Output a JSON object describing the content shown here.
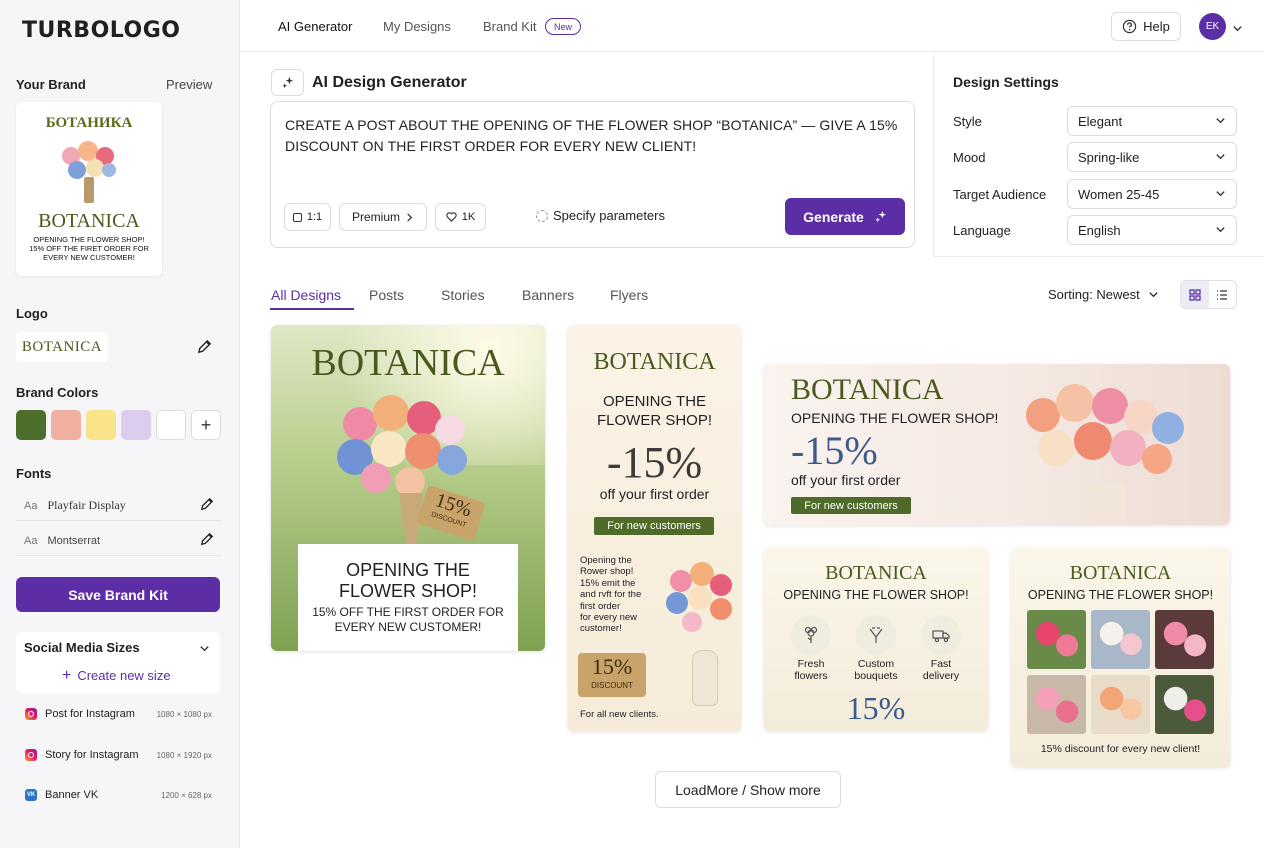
{
  "app": {
    "logo": "TURBOLOGO"
  },
  "sidebar": {
    "your_brand": "Your Brand",
    "preview": "Preview",
    "preview_card": {
      "title_ru": "БОТАНИКА",
      "title": "BOTANICA",
      "line1": "OPENING THE FLOWER SHOP!",
      "line2": "15% OFF THE FIRET ORDER FOR",
      "line3": "EVERY NEW CUSTOMER!"
    },
    "logo_label": "Logo",
    "logo_text": "BOTANICA",
    "brand_colors_label": "Brand Colors",
    "brand_colors": [
      "#4e6e2c",
      "#f0b0a0",
      "#f9e48a",
      "#dccdee",
      "#ffffff"
    ],
    "fonts_label": "Fonts",
    "fonts": [
      {
        "prefix": "Aa",
        "name": "Playfair Display"
      },
      {
        "prefix": "Aa",
        "name": "Montserrat"
      }
    ],
    "save_label": "Save Brand Kit",
    "sizes_label": "Social Media Sizes",
    "create_size": "Create new size",
    "sizes": [
      {
        "name": "Post for Instagram",
        "dims": "1080 × 1080 px"
      },
      {
        "name": "Story for Instagram",
        "dims": "1080 × 1920 px"
      },
      {
        "name": "Banner VK",
        "dims": "1200 × 628 px",
        "icon_text": "VK"
      }
    ]
  },
  "topnav": {
    "items": [
      "AI Generator",
      "My Designs",
      "Brand Kit"
    ],
    "new_badge": "New",
    "help": "Help",
    "avatar": "EK"
  },
  "generator": {
    "title": "AI Design Generator",
    "prompt": "CREATE A POST ABOUT THE OPENING OF THE FLOWER SHOP “BOTANICA” — GIVE A 15% DISCOUNT ON THE FIRST ORDER FOR EVERY NEW CLIENT!",
    "ratio": "1:1",
    "quality": "Premium",
    "count": "1K",
    "specify": "Specify parameters",
    "generate": "Generate"
  },
  "settings": {
    "title": "Design Settings",
    "fields": [
      {
        "label": "Style",
        "value": "Elegant"
      },
      {
        "label": "Mood",
        "value": "Spring-like"
      },
      {
        "label": "Target Audience",
        "value": "Women 25-45"
      },
      {
        "label": "Language",
        "value": "English"
      }
    ]
  },
  "tabs": [
    "All Designs",
    "Posts",
    "Stories",
    "Banners",
    "Flyers"
  ],
  "sorting": "Sorting: Newest",
  "designs": {
    "post": {
      "title": "BOTANICA",
      "tag": "15%",
      "tag_sub": "DISCOUNT",
      "line1": "OPENING THE",
      "line2": "FLOWER SHOP!",
      "line3": "15% OFF THE FIRST ORDER FOR",
      "line4": "EVERY NEW CUSTOMER!"
    },
    "story": {
      "title": "BOTANICA",
      "line1": "OPENING THE",
      "line2": "FLOWER SHOP!",
      "discount": "-15%",
      "sub": "off your first order",
      "pill": "For new customers",
      "para": [
        "Opening the",
        "Rower shop!",
        "15% emit the",
        "and rvft for the",
        "first order",
        "for every new",
        "customer!"
      ],
      "tag": "15%",
      "tag_sub": "DISCOUNT",
      "footer": "For all new clients."
    },
    "banner": {
      "title": "BOTANICA",
      "headline": "OPENING THE FLOWER SHOP!",
      "discount": "-15%",
      "sub": "off your first order",
      "pill": "For new customers"
    },
    "features": {
      "title": "BOTANICA",
      "headline": "OPENING THE FLOWER SHOP!",
      "items": [
        {
          "l1": "Fresh",
          "l2": "flowers"
        },
        {
          "l1": "Custom",
          "l2": "bouquets"
        },
        {
          "l1": "Fast",
          "l2": "delivery"
        }
      ],
      "discount": "15%"
    },
    "grid": {
      "title": "BOTANICA",
      "headline": "OPENING THE FLOWER SHOP!",
      "footer": "15% discount for every new client!"
    }
  },
  "load_more": "LoadMore / Show more"
}
